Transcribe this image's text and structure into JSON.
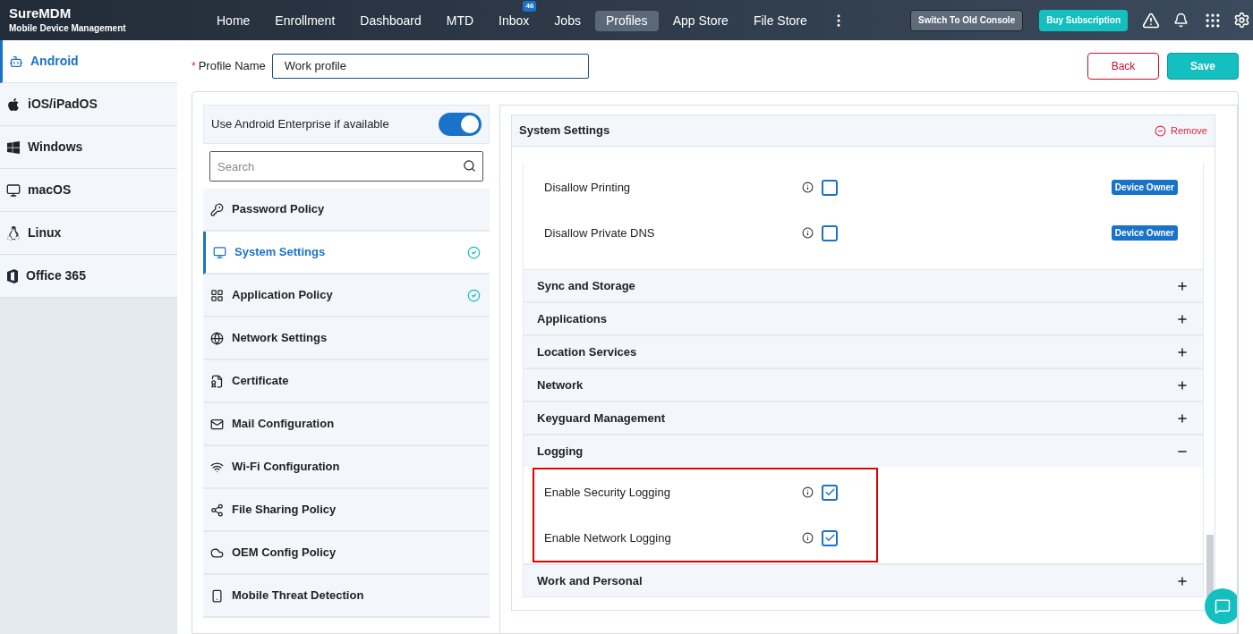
{
  "brand": {
    "name": "SureMDM",
    "subtitle": "Mobile Device Management"
  },
  "nav": [
    {
      "label": "Home",
      "selected": false
    },
    {
      "label": "Enrollment",
      "selected": false
    },
    {
      "label": "Dashboard",
      "selected": false
    },
    {
      "label": "MTD",
      "selected": false
    },
    {
      "label": "Inbox",
      "selected": false,
      "badge": "46"
    },
    {
      "label": "Jobs",
      "selected": false
    },
    {
      "label": "Profiles",
      "selected": true
    },
    {
      "label": "App Store",
      "selected": false
    },
    {
      "label": "File Store",
      "selected": false
    }
  ],
  "header_buttons": {
    "switch": "Switch To Old Console",
    "buy": "Buy Subscription"
  },
  "platforms": [
    {
      "label": "Android",
      "selected": true
    },
    {
      "label": "iOS/iPadOS",
      "selected": false
    },
    {
      "label": "Windows",
      "selected": false
    },
    {
      "label": "macOS",
      "selected": false
    },
    {
      "label": "Linux",
      "selected": false
    },
    {
      "label": "Office 365",
      "selected": false
    }
  ],
  "profile_name": {
    "required_mark": "*",
    "label": "Profile Name",
    "value": "Work profile"
  },
  "actions": {
    "back": "Back",
    "save": "Save"
  },
  "enterprise_toggle": {
    "label": "Use Android Enterprise if available",
    "on": true
  },
  "search": {
    "placeholder": "Search"
  },
  "policies": [
    {
      "label": "Password Policy",
      "selected": false,
      "done": false
    },
    {
      "label": "System Settings",
      "selected": true,
      "done": true
    },
    {
      "label": "Application Policy",
      "selected": false,
      "done": true
    },
    {
      "label": "Network Settings",
      "selected": false,
      "done": false
    },
    {
      "label": "Certificate",
      "selected": false,
      "done": false
    },
    {
      "label": "Mail Configuration",
      "selected": false,
      "done": false
    },
    {
      "label": "Wi-Fi Configuration",
      "selected": false,
      "done": false
    },
    {
      "label": "File Sharing Policy",
      "selected": false,
      "done": false
    },
    {
      "label": "OEM Config Policy",
      "selected": false,
      "done": false
    },
    {
      "label": "Mobile Threat Detection",
      "selected": false,
      "done": false
    }
  ],
  "settings_card": {
    "title": "System Settings",
    "remove": "Remove",
    "rows": [
      {
        "label": "Disallow Printing",
        "checked": false,
        "badge": "Device Owner"
      },
      {
        "label": "Disallow Private DNS",
        "checked": false,
        "badge": "Device Owner"
      }
    ],
    "sections": [
      {
        "title": "Sync and Storage",
        "expanded": false
      },
      {
        "title": "Applications",
        "expanded": false
      },
      {
        "title": "Location Services",
        "expanded": false
      },
      {
        "title": "Network",
        "expanded": false
      },
      {
        "title": "Keyguard Management",
        "expanded": false
      },
      {
        "title": "Logging",
        "expanded": true,
        "highlighted": true,
        "rows": [
          {
            "label": "Enable Security Logging",
            "checked": true
          },
          {
            "label": "Enable Network Logging",
            "checked": true
          }
        ]
      },
      {
        "title": "Work and Personal",
        "expanded": false
      }
    ]
  }
}
